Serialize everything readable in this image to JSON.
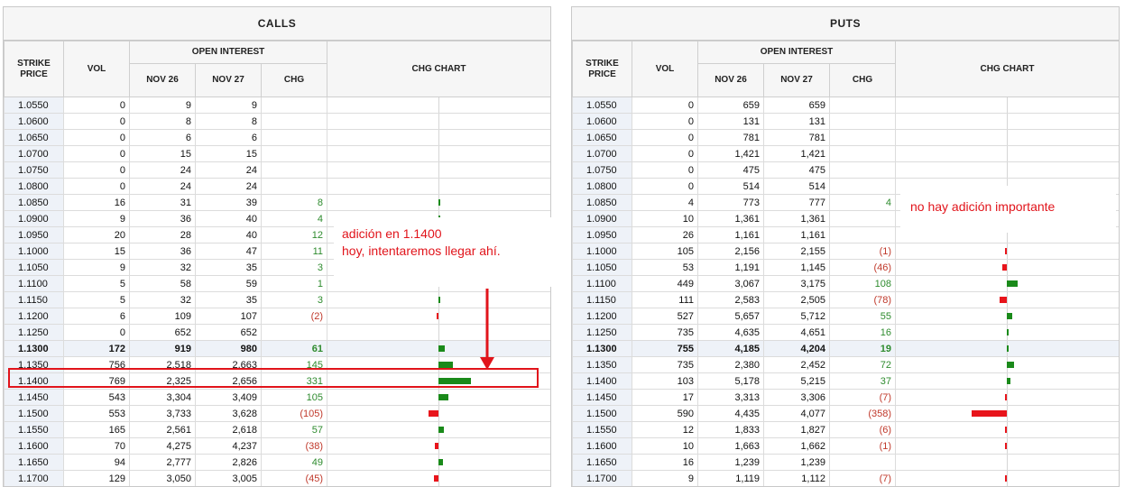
{
  "headers": {
    "strike": "STRIKE PRICE",
    "vol": "VOL",
    "open_interest": "OPEN INTEREST",
    "nov26": "NOV 26",
    "nov27": "NOV 27",
    "chg": "CHG",
    "chg_chart": "CHG CHART"
  },
  "colors": {
    "positive": "#1a8a1a",
    "negative": "#e8141b",
    "annotation": "#e1141b",
    "highlight_row": "#eef2f8"
  },
  "calls": {
    "title": "CALLS",
    "rows": [
      {
        "strike": "1.0550",
        "vol": "0",
        "nov26": "9",
        "nov27": "9",
        "chg": "",
        "chg_value": 0,
        "bold": false
      },
      {
        "strike": "1.0600",
        "vol": "0",
        "nov26": "8",
        "nov27": "8",
        "chg": "",
        "chg_value": 0,
        "bold": false
      },
      {
        "strike": "1.0650",
        "vol": "0",
        "nov26": "6",
        "nov27": "6",
        "chg": "",
        "chg_value": 0,
        "bold": false
      },
      {
        "strike": "1.0700",
        "vol": "0",
        "nov26": "15",
        "nov27": "15",
        "chg": "",
        "chg_value": 0,
        "bold": false
      },
      {
        "strike": "1.0750",
        "vol": "0",
        "nov26": "24",
        "nov27": "24",
        "chg": "",
        "chg_value": 0,
        "bold": false
      },
      {
        "strike": "1.0800",
        "vol": "0",
        "nov26": "24",
        "nov27": "24",
        "chg": "",
        "chg_value": 0,
        "bold": false
      },
      {
        "strike": "1.0850",
        "vol": "16",
        "nov26": "31",
        "nov27": "39",
        "chg": "8",
        "chg_value": 8,
        "bold": false
      },
      {
        "strike": "1.0900",
        "vol": "9",
        "nov26": "36",
        "nov27": "40",
        "chg": "4",
        "chg_value": 4,
        "bold": false
      },
      {
        "strike": "1.0950",
        "vol": "20",
        "nov26": "28",
        "nov27": "40",
        "chg": "12",
        "chg_value": 12,
        "bold": false
      },
      {
        "strike": "1.1000",
        "vol": "15",
        "nov26": "36",
        "nov27": "47",
        "chg": "11",
        "chg_value": 11,
        "bold": false
      },
      {
        "strike": "1.1050",
        "vol": "9",
        "nov26": "32",
        "nov27": "35",
        "chg": "3",
        "chg_value": 3,
        "bold": false
      },
      {
        "strike": "1.1100",
        "vol": "5",
        "nov26": "58",
        "nov27": "59",
        "chg": "1",
        "chg_value": 1,
        "bold": false
      },
      {
        "strike": "1.1150",
        "vol": "5",
        "nov26": "32",
        "nov27": "35",
        "chg": "3",
        "chg_value": 3,
        "bold": false
      },
      {
        "strike": "1.1200",
        "vol": "6",
        "nov26": "109",
        "nov27": "107",
        "chg": "(2)",
        "chg_value": -2,
        "bold": false
      },
      {
        "strike": "1.1250",
        "vol": "0",
        "nov26": "652",
        "nov27": "652",
        "chg": "",
        "chg_value": 0,
        "bold": false
      },
      {
        "strike": "1.1300",
        "vol": "172",
        "nov26": "919",
        "nov27": "980",
        "chg": "61",
        "chg_value": 61,
        "bold": true
      },
      {
        "strike": "1.1350",
        "vol": "756",
        "nov26": "2,518",
        "nov27": "2,663",
        "chg": "145",
        "chg_value": 145,
        "bold": false
      },
      {
        "strike": "1.1400",
        "vol": "769",
        "nov26": "2,325",
        "nov27": "2,656",
        "chg": "331",
        "chg_value": 331,
        "bold": false
      },
      {
        "strike": "1.1450",
        "vol": "543",
        "nov26": "3,304",
        "nov27": "3,409",
        "chg": "105",
        "chg_value": 105,
        "bold": false
      },
      {
        "strike": "1.1500",
        "vol": "553",
        "nov26": "3,733",
        "nov27": "3,628",
        "chg": "(105)",
        "chg_value": -105,
        "bold": false
      },
      {
        "strike": "1.1550",
        "vol": "165",
        "nov26": "2,561",
        "nov27": "2,618",
        "chg": "57",
        "chg_value": 57,
        "bold": false
      },
      {
        "strike": "1.1600",
        "vol": "70",
        "nov26": "4,275",
        "nov27": "4,237",
        "chg": "(38)",
        "chg_value": -38,
        "bold": false
      },
      {
        "strike": "1.1650",
        "vol": "94",
        "nov26": "2,777",
        "nov27": "2,826",
        "chg": "49",
        "chg_value": 49,
        "bold": false
      },
      {
        "strike": "1.1700",
        "vol": "129",
        "nov26": "3,050",
        "nov27": "3,005",
        "chg": "(45)",
        "chg_value": -45,
        "bold": false
      }
    ]
  },
  "puts": {
    "title": "PUTS",
    "rows": [
      {
        "strike": "1.0550",
        "vol": "0",
        "nov26": "659",
        "nov27": "659",
        "chg": "",
        "chg_value": 0,
        "bold": false
      },
      {
        "strike": "1.0600",
        "vol": "0",
        "nov26": "131",
        "nov27": "131",
        "chg": "",
        "chg_value": 0,
        "bold": false
      },
      {
        "strike": "1.0650",
        "vol": "0",
        "nov26": "781",
        "nov27": "781",
        "chg": "",
        "chg_value": 0,
        "bold": false
      },
      {
        "strike": "1.0700",
        "vol": "0",
        "nov26": "1,421",
        "nov27": "1,421",
        "chg": "",
        "chg_value": 0,
        "bold": false
      },
      {
        "strike": "1.0750",
        "vol": "0",
        "nov26": "475",
        "nov27": "475",
        "chg": "",
        "chg_value": 0,
        "bold": false
      },
      {
        "strike": "1.0800",
        "vol": "0",
        "nov26": "514",
        "nov27": "514",
        "chg": "",
        "chg_value": 0,
        "bold": false
      },
      {
        "strike": "1.0850",
        "vol": "4",
        "nov26": "773",
        "nov27": "777",
        "chg": "4",
        "chg_value": 4,
        "bold": false
      },
      {
        "strike": "1.0900",
        "vol": "10",
        "nov26": "1,361",
        "nov27": "1,361",
        "chg": "",
        "chg_value": 0,
        "bold": false
      },
      {
        "strike": "1.0950",
        "vol": "26",
        "nov26": "1,161",
        "nov27": "1,161",
        "chg": "",
        "chg_value": 0,
        "bold": false
      },
      {
        "strike": "1.1000",
        "vol": "105",
        "nov26": "2,156",
        "nov27": "2,155",
        "chg": "(1)",
        "chg_value": -1,
        "bold": false
      },
      {
        "strike": "1.1050",
        "vol": "53",
        "nov26": "1,191",
        "nov27": "1,145",
        "chg": "(46)",
        "chg_value": -46,
        "bold": false
      },
      {
        "strike": "1.1100",
        "vol": "449",
        "nov26": "3,067",
        "nov27": "3,175",
        "chg": "108",
        "chg_value": 108,
        "bold": false
      },
      {
        "strike": "1.1150",
        "vol": "111",
        "nov26": "2,583",
        "nov27": "2,505",
        "chg": "(78)",
        "chg_value": -78,
        "bold": false
      },
      {
        "strike": "1.1200",
        "vol": "527",
        "nov26": "5,657",
        "nov27": "5,712",
        "chg": "55",
        "chg_value": 55,
        "bold": false
      },
      {
        "strike": "1.1250",
        "vol": "735",
        "nov26": "4,635",
        "nov27": "4,651",
        "chg": "16",
        "chg_value": 16,
        "bold": false
      },
      {
        "strike": "1.1300",
        "vol": "755",
        "nov26": "4,185",
        "nov27": "4,204",
        "chg": "19",
        "chg_value": 19,
        "bold": true
      },
      {
        "strike": "1.1350",
        "vol": "735",
        "nov26": "2,380",
        "nov27": "2,452",
        "chg": "72",
        "chg_value": 72,
        "bold": false
      },
      {
        "strike": "1.1400",
        "vol": "103",
        "nov26": "5,178",
        "nov27": "5,215",
        "chg": "37",
        "chg_value": 37,
        "bold": false
      },
      {
        "strike": "1.1450",
        "vol": "17",
        "nov26": "3,313",
        "nov27": "3,306",
        "chg": "(7)",
        "chg_value": -7,
        "bold": false
      },
      {
        "strike": "1.1500",
        "vol": "590",
        "nov26": "4,435",
        "nov27": "4,077",
        "chg": "(358)",
        "chg_value": -358,
        "bold": false
      },
      {
        "strike": "1.1550",
        "vol": "12",
        "nov26": "1,833",
        "nov27": "1,827",
        "chg": "(6)",
        "chg_value": -6,
        "bold": false
      },
      {
        "strike": "1.1600",
        "vol": "10",
        "nov26": "1,663",
        "nov27": "1,662",
        "chg": "(1)",
        "chg_value": -1,
        "bold": false
      },
      {
        "strike": "1.1650",
        "vol": "16",
        "nov26": "1,239",
        "nov27": "1,239",
        "chg": "",
        "chg_value": 0,
        "bold": false
      },
      {
        "strike": "1.1700",
        "vol": "9",
        "nov26": "1,119",
        "nov27": "1,112",
        "chg": "(7)",
        "chg_value": -7,
        "bold": false
      }
    ]
  },
  "annotations": {
    "calls_note_line1": "adición en 1.1400",
    "calls_note_line2": "hoy, intentaremos llegar ahí.",
    "puts_note": "no hay adición importante",
    "highlighted_strike": "1.1400"
  }
}
